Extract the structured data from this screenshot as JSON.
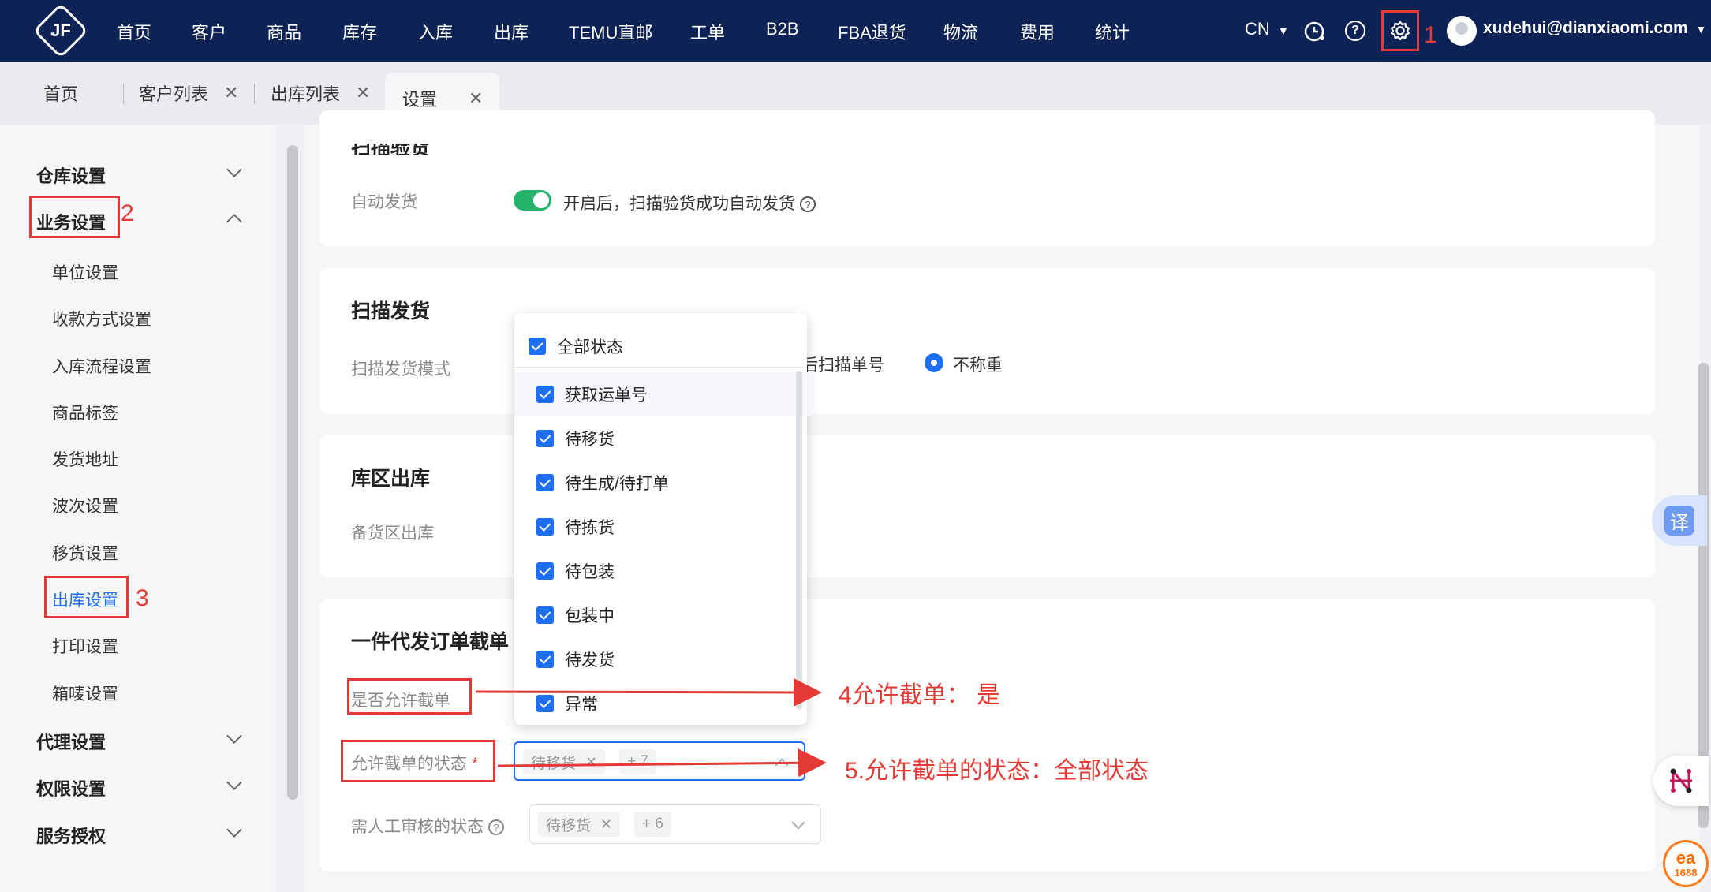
{
  "app": {
    "logo_text": "JF"
  },
  "nav": {
    "items": [
      "首页",
      "客户",
      "商品",
      "库存",
      "入库",
      "出库",
      "TEMU直邮",
      "工单",
      "B2B",
      "FBA退货",
      "物流",
      "费用",
      "统计"
    ],
    "lang": "CN",
    "user": "xudehui@dianxiaomi.com"
  },
  "tabs": [
    {
      "label": "首页",
      "closable": false
    },
    {
      "label": "客户列表",
      "closable": true
    },
    {
      "label": "出库列表",
      "closable": true
    },
    {
      "label": "设置",
      "closable": true,
      "active": true
    }
  ],
  "close_glyph": "✕",
  "sidebar": {
    "groups": [
      {
        "label": "仓库设置",
        "expanded": false
      },
      {
        "label": "业务设置",
        "expanded": true
      },
      {
        "label": "代理设置",
        "expanded": false
      },
      {
        "label": "权限设置",
        "expanded": false
      },
      {
        "label": "服务授权",
        "expanded": false
      }
    ],
    "business_items": [
      "单位设置",
      "收款方式设置",
      "入库流程设置",
      "商品标签",
      "发货地址",
      "波次设置",
      "移货设置",
      "出库设置",
      "打印设置",
      "箱唛设置"
    ],
    "active_item": "出库设置"
  },
  "main": {
    "scan_verify": {
      "title": "扫描验货",
      "auto_ship_label": "自动发货",
      "auto_ship_enabled": true,
      "auto_ship_desc": "开启后，扫描验货成功自动发货"
    },
    "scan_ship": {
      "title": "扫描发货",
      "mode_label": "扫描发货模式",
      "partial_option": "后扫描单号",
      "selected_option": "不称重"
    },
    "zone_outbound": {
      "title": "库区出库",
      "label": "备货区出库"
    },
    "dropship": {
      "title": "一件代发订单截单",
      "allow_cut_label": "是否允许截单",
      "allow_states_label": "允许截单的状态",
      "allow_states_tag": "待移货",
      "allow_states_more": "+ 7",
      "review_states_label": "需人工审核的状态",
      "review_states_tag": "待移货",
      "review_states_more": "+ 6"
    }
  },
  "dropdown": {
    "all_label": "全部状态",
    "items": [
      "获取运单号",
      "待移货",
      "待生成/待打单",
      "待拣货",
      "待包装",
      "包装中",
      "待发货",
      "异常"
    ]
  },
  "annotations": {
    "n1": "1",
    "n2": "2",
    "n3": "3",
    "n4": "4允许截单： 是",
    "n5": "5.允许截单的状态：全部状态"
  },
  "widgets": {
    "translate": "译",
    "badge": "1688"
  },
  "colors": {
    "nav_bg": "#0e2355",
    "accent": "#1e6ff1",
    "toggle_on": "#24b36b",
    "annotation": "#e53935"
  }
}
